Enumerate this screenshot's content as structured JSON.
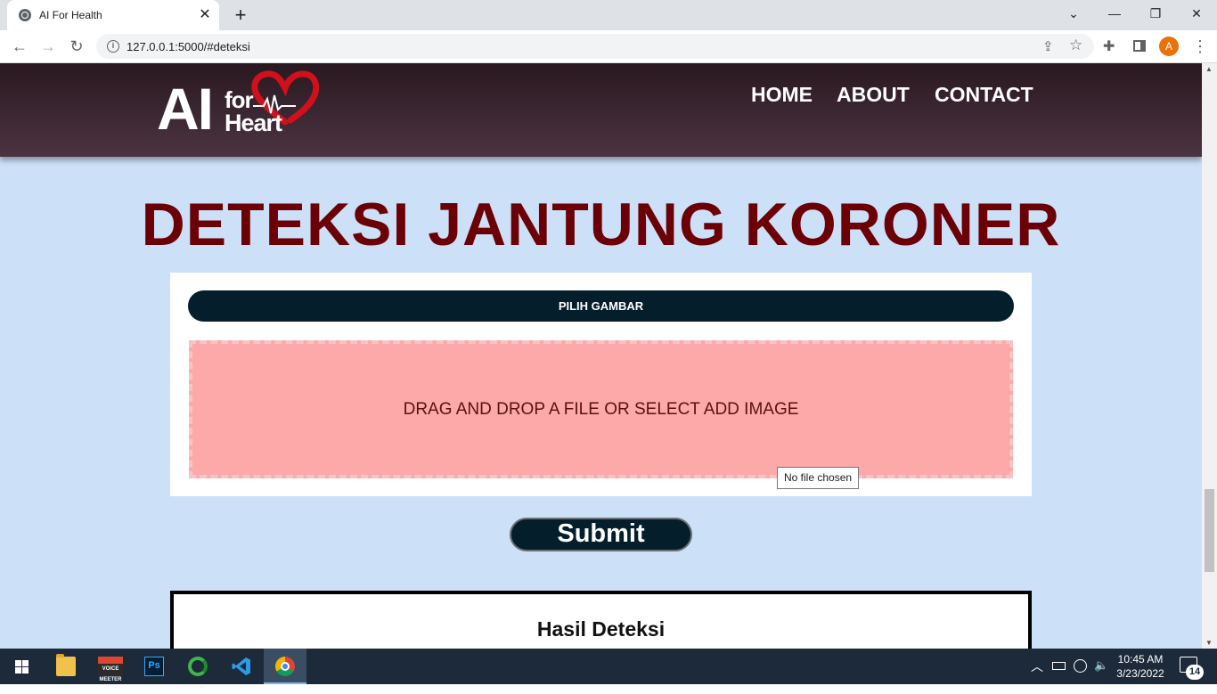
{
  "browser": {
    "tab_title": "AI For Health",
    "url": "127.0.0.1:5000/#deteksi",
    "profile_initial": "A"
  },
  "site": {
    "logo": {
      "big": "AI",
      "small_top": "for",
      "small_bottom": "Heart",
      "heart_color": "#d0111b"
    },
    "nav": {
      "home": "HOME",
      "about": "ABOUT",
      "contact": "CONTACT"
    },
    "page_title": "DETEKSI JANTUNG KORONER",
    "upload": {
      "pick_label": "PILIH GAMBAR",
      "dropzone_text": "DRAG AND DROP A FILE OR SELECT ADD IMAGE",
      "file_status": "No file chosen"
    },
    "submit_label": "Submit",
    "result_title": "Hasil Deteksi"
  },
  "taskbar": {
    "apps": [
      "windows-start",
      "file-explorer",
      "voicemeeter",
      "photoshop",
      "green-ring-app",
      "vscode",
      "chrome"
    ],
    "voicemeeter_label": "VOICE MEETER",
    "photoshop_label": "Ps",
    "time": "10:45 AM",
    "date": "3/23/2022",
    "notification_count": "14"
  },
  "colors": {
    "page_bg": "#cce0f8",
    "title": "#6b0006",
    "button_bg": "#041e2b",
    "dropzone_bg": "#fda9a9"
  }
}
